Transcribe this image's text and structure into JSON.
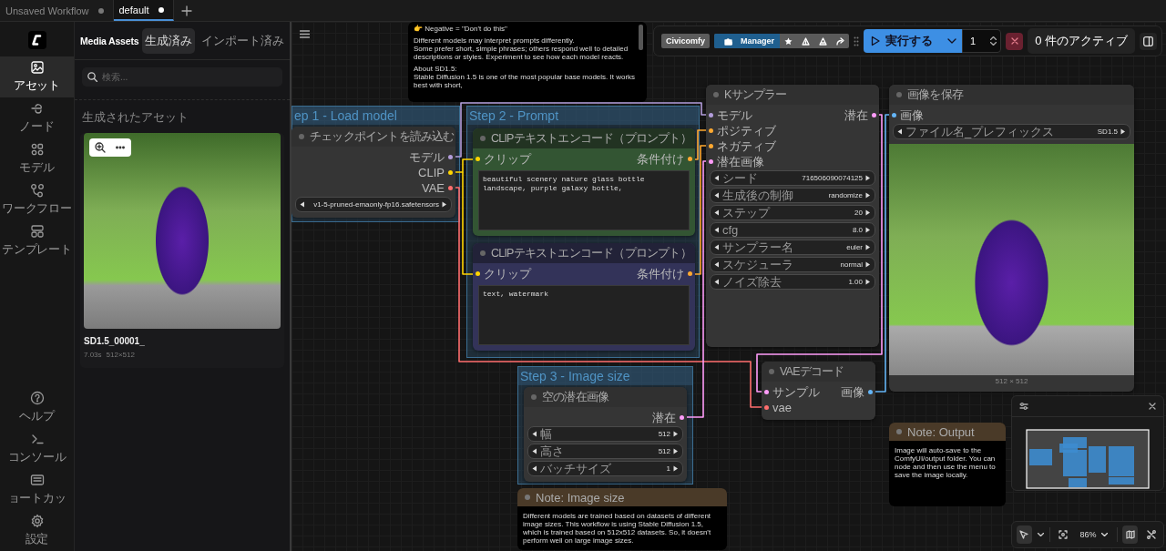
{
  "tabs": [
    {
      "label": "Unsaved Workflow",
      "selected": false,
      "modified": true
    },
    {
      "label": "default",
      "selected": true,
      "modified": true
    }
  ],
  "side_rail": {
    "items": [
      {
        "label": "アセット",
        "selected": true
      },
      {
        "label": "ノード",
        "selected": false
      },
      {
        "label": "モデル",
        "selected": false
      },
      {
        "label": "ワークフロー",
        "selected": false
      },
      {
        "label": "テンプレート",
        "selected": false
      }
    ],
    "bottom_items": [
      {
        "label": "ヘルプ"
      },
      {
        "label": "コンソール"
      },
      {
        "label": "ョートカッ"
      },
      {
        "label": "設定"
      }
    ]
  },
  "assets": {
    "title": "Media Assets",
    "tabs": [
      {
        "label": "生成済み",
        "selected": true
      },
      {
        "label": "インポート済み",
        "selected": false
      }
    ],
    "search": {
      "placeholder": "検索..."
    },
    "section_title": "生成されたアセット",
    "items": [
      {
        "name": "SD1.5_00001_",
        "duration": "7.03s",
        "dimensions": "512×512"
      }
    ]
  },
  "canvas": {
    "groups": [
      {
        "title": "ep 1 - Load model"
      },
      {
        "title": "Step 2 - Prompt"
      },
      {
        "title": "Step 3 - Image size"
      }
    ],
    "nodes": [
      {
        "kind": "loader",
        "title": "チェックポイントを読み込む",
        "outputs": [
          {
            "label": "モデル",
            "color": "#b39ddb"
          },
          {
            "label": "CLIP",
            "color": "#ffd500"
          },
          {
            "label": "VAE",
            "color": "#ff6e6e"
          }
        ],
        "widgets": [
          {
            "value": "v1-5-pruned-emaonly-fp16.safetensors"
          }
        ]
      },
      {
        "kind": "positive",
        "title": "CLIPテキストエンコード（プロンプト）",
        "inputs": [
          {
            "label": "クリップ",
            "color": "#ffd500"
          }
        ],
        "outputs": [
          {
            "label": "条件付け",
            "color": "#ffa931"
          }
        ],
        "text": "beautiful scenery nature glass bottle landscape, purple galaxy bottle,"
      },
      {
        "kind": "negative",
        "title": "CLIPテキストエンコード（プロンプト）",
        "inputs": [
          {
            "label": "クリップ",
            "color": "#ffd500"
          }
        ],
        "outputs": [
          {
            "label": "条件付け",
            "color": "#ffa931"
          }
        ],
        "text": "text, watermark"
      },
      {
        "kind": "sampler",
        "title": "Kサンプラー",
        "inputs": [
          {
            "label": "モデル",
            "color": "#b39ddb"
          },
          {
            "label": "ポジティブ",
            "color": "#ffa931"
          },
          {
            "label": "ネガティブ",
            "color": "#ffa931"
          },
          {
            "label": "潜在画像",
            "color": "#ff9cf9"
          }
        ],
        "outputs": [
          {
            "label": "潜在",
            "color": "#ff9cf9"
          }
        ],
        "widgets": [
          {
            "label": "シード",
            "value": "716506090074125"
          },
          {
            "label": "生成後の制御",
            "value": "randomize"
          },
          {
            "label": "ステップ",
            "value": "20"
          },
          {
            "label": "cfg",
            "value": "8.0"
          },
          {
            "label": "サンプラー名",
            "value": "euler"
          },
          {
            "label": "スケジューラ",
            "value": "normal"
          },
          {
            "label": "ノイズ除去",
            "value": "1.00"
          }
        ]
      },
      {
        "kind": "save",
        "title": "画像を保存",
        "inputs": [
          {
            "label": "画像",
            "color": "#64b5f6"
          }
        ],
        "widgets": [
          {
            "label": "ファイル名_プレフィックス",
            "value": "SD1.5"
          }
        ],
        "image": {
          "caption": "512 × 512"
        }
      },
      {
        "kind": "latent",
        "title": "空の潜在画像",
        "outputs": [
          {
            "label": "潜在",
            "color": "#ff9cf9"
          }
        ],
        "widgets": [
          {
            "label": "幅",
            "value": "512"
          },
          {
            "label": "高さ",
            "value": "512"
          },
          {
            "label": "バッチサイズ",
            "value": "1"
          }
        ]
      },
      {
        "kind": "decode",
        "title": "VAEデコード",
        "inputs": [
          {
            "label": "サンプル",
            "color": "#ff9cf9"
          },
          {
            "label": "vae",
            "color": "#ff6e6e"
          }
        ],
        "outputs": [
          {
            "label": "画像",
            "color": "#64b5f6"
          }
        ]
      }
    ],
    "notes": [
      {
        "paragraphs": [
          "👉 Negative = \"Don't do this\"",
          "Different models may interpret prompts differently.\nSome prefer short, simple phrases; others respond well to detailed descriptions or styles. Experiment to see how each model reacts.",
          "About SD1.5:\nStable Diffusion 1.5 is one of the most popular base models. It works best with short,"
        ]
      },
      {
        "title": "Note: Image size",
        "paragraphs": [
          "Different models are trained based on datasets of different image sizes. This workflow is using Stable Diffusion 1.5, which is trained based on 512x512 datasets. So, it doesn't perform well on large image sizes."
        ]
      },
      {
        "title": "Note: Output",
        "paragraphs": [
          "Image will auto-save to the ComfyUI/output folder. You can",
          "node and then use the menu to save the image locally."
        ]
      }
    ],
    "toolbar": {
      "civicomfy": "Civicomfy",
      "manager": "Manager",
      "run": "実行する",
      "batch_count": "1",
      "queue_status": "0 件のアクティブ"
    },
    "controls": {
      "select_tool_selected": true,
      "zoom": "86%",
      "minimap_on": true
    }
  }
}
